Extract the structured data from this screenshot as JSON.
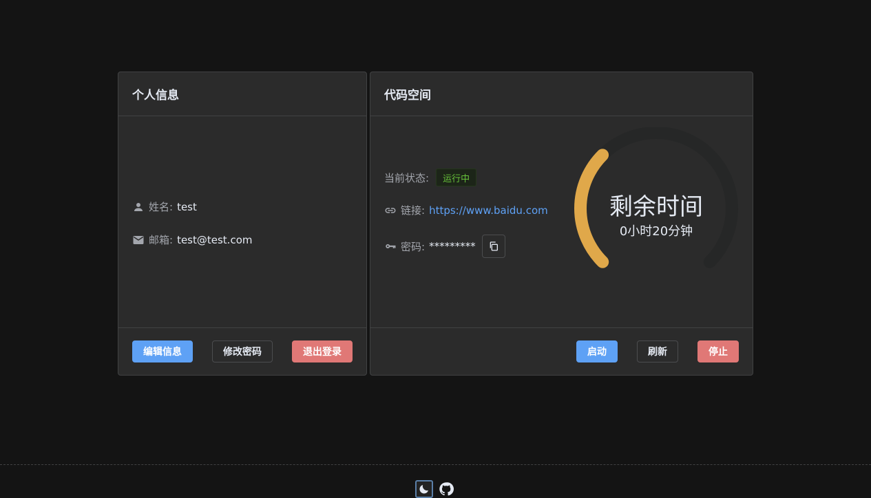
{
  "profile": {
    "title": "个人信息",
    "name_label": "姓名:",
    "name_value": "test",
    "email_label": "邮箱:",
    "email_value": "test@test.com",
    "edit_label": "编辑信息",
    "password_label": "修改密码",
    "logout_label": "退出登录"
  },
  "space": {
    "title": "代码空间",
    "status_label": "当前状态:",
    "status_value": "运行中",
    "link_label": "链接:",
    "link_value": "https://www.baidu.com",
    "password_label": "密码:",
    "password_value": "*********",
    "gauge_title": "剩余时间",
    "gauge_value": "0小时20分钟",
    "gauge_fraction": 0.333,
    "start_label": "启动",
    "refresh_label": "刷新",
    "stop_label": "停止"
  },
  "colors": {
    "primary": "#5ea1f5",
    "danger": "#e07876",
    "success": "#67c23a",
    "gauge_fill": "#e0a84a",
    "gauge_track": "#262727"
  },
  "footer": {
    "theme_icon": "moon-icon",
    "repo_icon": "github-icon"
  }
}
